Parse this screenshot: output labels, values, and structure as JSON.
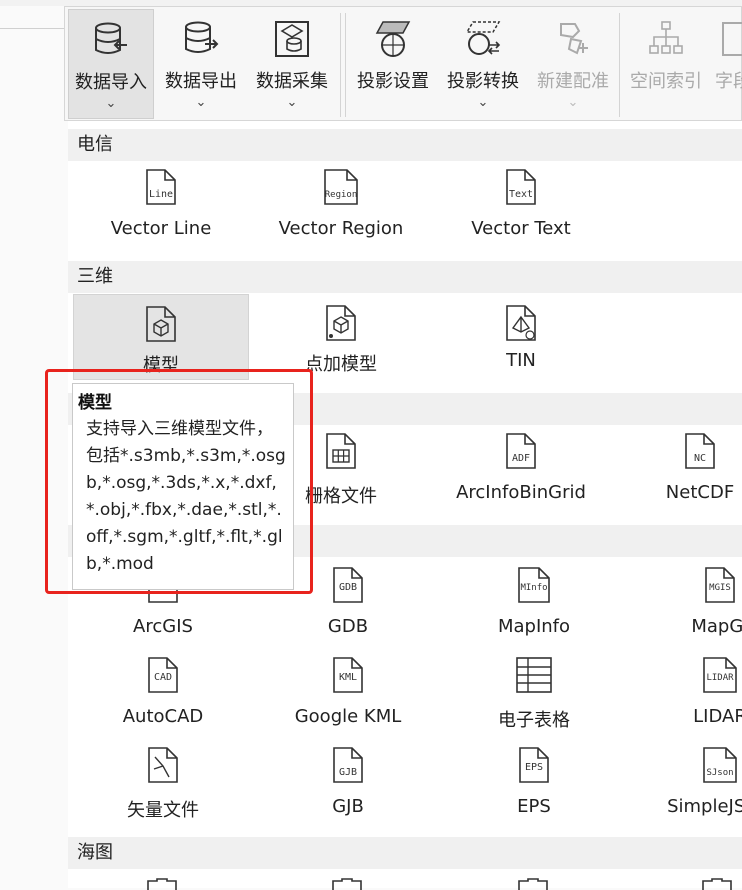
{
  "ribbon": {
    "buttons": [
      {
        "label": "数据导入",
        "icon": "database-import-icon",
        "dropdown": true,
        "active": true
      },
      {
        "label": "数据导出",
        "icon": "database-export-icon",
        "dropdown": true
      },
      {
        "label": "数据采集",
        "icon": "data-collect-icon",
        "dropdown": true
      },
      {
        "label": "投影设置",
        "icon": "projection-settings-icon",
        "dropdown": false
      },
      {
        "label": "投影转换",
        "icon": "projection-transform-icon",
        "dropdown": true
      },
      {
        "label": "新建配准",
        "icon": "new-registration-icon",
        "dropdown": true,
        "disabled": true
      },
      {
        "label": "空间索引",
        "icon": "spatial-index-icon",
        "dropdown": false,
        "disabled": true
      },
      {
        "label": "字段",
        "icon": "field-icon",
        "dropdown": false,
        "disabled": true
      }
    ],
    "chevron": "⌄"
  },
  "sections": {
    "telecom": {
      "title": "电信",
      "items": [
        {
          "label": "Vector Line",
          "badge": "Line"
        },
        {
          "label": "Vector Region",
          "badge": "Region"
        },
        {
          "label": "Vector Text",
          "badge": "Text"
        }
      ]
    },
    "threed": {
      "title": "三维",
      "items": [
        {
          "label": "模型",
          "icon": "cube-icon"
        },
        {
          "label": "点加模型",
          "icon": "point-cube-icon"
        },
        {
          "label": "TIN",
          "icon": "tin-icon"
        }
      ]
    },
    "raster": {
      "items": [
        {
          "label": "栅格文件",
          "icon": "grid-file-icon"
        },
        {
          "label": "ArcInfoBinGrid",
          "badge": "ADF"
        },
        {
          "label": "NetCDF",
          "badge": "NC"
        }
      ]
    },
    "vector": {
      "rows": [
        [
          {
            "label": "ArcGIS",
            "badge": ""
          },
          {
            "label": "GDB",
            "badge": "GDB"
          },
          {
            "label": "MapInfo",
            "badge": "MInfo"
          },
          {
            "label": "MapGI",
            "badge": "MGIS"
          }
        ],
        [
          {
            "label": "AutoCAD",
            "badge": "CAD"
          },
          {
            "label": "Google KML",
            "badge": "KML"
          },
          {
            "label": "电子表格",
            "icon": "spreadsheet-icon"
          },
          {
            "label": "LIDAR",
            "badge": "LIDAR"
          }
        ],
        [
          {
            "label": "矢量文件",
            "icon": "vector-file-icon"
          },
          {
            "label": "GJB",
            "badge": "GJB"
          },
          {
            "label": "EPS",
            "badge": "EPS"
          },
          {
            "label": "SimpleJSON",
            "badge": "SJson"
          }
        ]
      ]
    },
    "chart": {
      "title": "海图"
    }
  },
  "tooltip": {
    "title": "模型",
    "body": "支持导入三维模型文件，包括*.s3mb,*.s3m,*.osgb,*.osg,*.3ds,*.x,*.dxf,*.obj,*.fbx,*.dae,*.stl,*.off,*.sgm,*.gltf,*.flt,*.glb,*.mod"
  },
  "colors": {
    "highlight": "#e8231d",
    "section_header": "#f0f0f0",
    "hover": "#e4e4e4"
  }
}
